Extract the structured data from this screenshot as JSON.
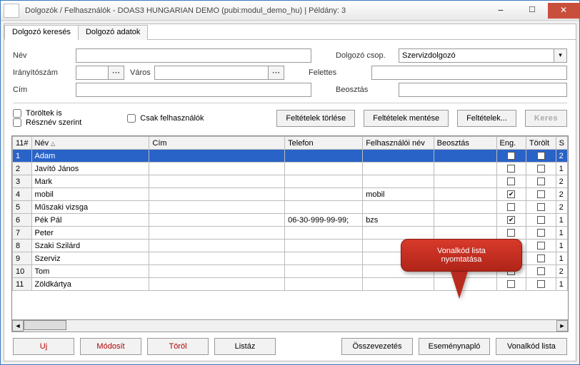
{
  "window": {
    "title": "Dolgozók / Felhasználók - DOAS3 HUNGARIAN DEMO (pubi:modul_demo_hu) | Példány: 3"
  },
  "tabs": {
    "search": "Dolgozó keresés",
    "details": "Dolgozó adatok"
  },
  "filters": {
    "name_label": "Név",
    "zip_label": "Irányítószám",
    "city_label": "Város",
    "addr_label": "Cím",
    "group_label": "Dolgozó csop.",
    "group_value": "Szervizdolgozó",
    "superior_label": "Felettes",
    "position_label": "Beosztás"
  },
  "options": {
    "deleted_too": "Töröltek is",
    "partial_name": "Résznév szerint",
    "users_only": "Csak felhasználók"
  },
  "buttons": {
    "clear_filters": "Feltételek törlése",
    "save_filters": "Feltételek mentése",
    "filters": "Feltételek...",
    "search": "Keres",
    "new": "Uj",
    "modify": "Módosít",
    "delete": "Töröl",
    "list": "Listáz",
    "merge": "Összevezetés",
    "eventlog": "Eseménynapló",
    "barcode_list": "Vonalkód lista"
  },
  "columns": {
    "rowhead": "11#",
    "name": "Név",
    "addr": "Cím",
    "phone": "Telefon",
    "username": "Felhasználói név",
    "position": "Beosztás",
    "enabled": "Eng.",
    "deleted": "Törölt",
    "s": "S"
  },
  "rows": [
    {
      "n": "1",
      "name": "Adam",
      "addr": "",
      "phone": "",
      "user": "",
      "pos": "",
      "eng": false,
      "del": false,
      "s": "2",
      "selected": true
    },
    {
      "n": "2",
      "name": "Javító János",
      "addr": "",
      "phone": "",
      "user": "",
      "pos": "",
      "eng": false,
      "del": false,
      "s": "1"
    },
    {
      "n": "3",
      "name": "Mark",
      "addr": "",
      "phone": "",
      "user": "",
      "pos": "",
      "eng": false,
      "del": false,
      "s": "2"
    },
    {
      "n": "4",
      "name": "mobil",
      "addr": "",
      "phone": "",
      "user": "mobil",
      "pos": "",
      "eng": true,
      "del": false,
      "s": "2"
    },
    {
      "n": "5",
      "name": "Műszaki vizsga",
      "addr": "",
      "phone": "",
      "user": "",
      "pos": "",
      "eng": false,
      "del": false,
      "s": "2"
    },
    {
      "n": "6",
      "name": "Pék Pál",
      "addr": "",
      "phone": "06-30-999-99-99;",
      "user": "bzs",
      "pos": "",
      "eng": true,
      "del": false,
      "s": "1"
    },
    {
      "n": "7",
      "name": "Peter",
      "addr": "",
      "phone": "",
      "user": "",
      "pos": "",
      "eng": false,
      "del": false,
      "s": "1"
    },
    {
      "n": "8",
      "name": "Szaki Szilárd",
      "addr": "",
      "phone": "",
      "user": "",
      "pos": "",
      "eng": false,
      "del": false,
      "s": "1"
    },
    {
      "n": "9",
      "name": "Szerviz",
      "addr": "",
      "phone": "",
      "user": "",
      "pos": "",
      "eng": false,
      "del": false,
      "s": "1"
    },
    {
      "n": "10",
      "name": "Tom",
      "addr": "",
      "phone": "",
      "user": "",
      "pos": "",
      "eng": false,
      "del": false,
      "s": "2"
    },
    {
      "n": "11",
      "name": "Zöldkártya",
      "addr": "",
      "phone": "",
      "user": "",
      "pos": "",
      "eng": false,
      "del": false,
      "s": "1"
    }
  ],
  "callout": {
    "line1": "Vonalkód lista",
    "line2": "nyomtatása"
  }
}
